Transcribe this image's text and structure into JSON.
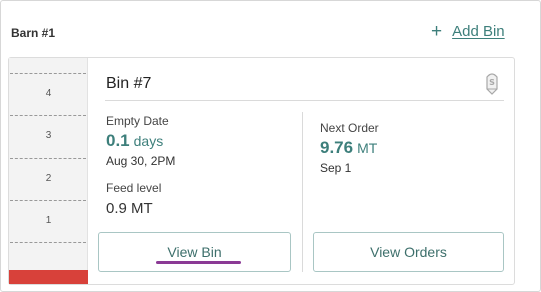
{
  "barn": {
    "name": "Barn #1"
  },
  "actions": {
    "add_bin_icon": "plus-icon",
    "add_bin_label": "Add Bin"
  },
  "bin": {
    "title": "Bin #7",
    "status_icon": "feed-bin-icon",
    "gauge": {
      "levels": [
        "4",
        "3",
        "2",
        "1"
      ],
      "fill_fraction": 0.06,
      "fill_color": "#d8413a"
    },
    "empty_date": {
      "label": "Empty Date",
      "value": "0.1",
      "unit": "days",
      "date": "Aug 30, 2PM"
    },
    "feed_level": {
      "label": "Feed level",
      "value": "0.9 MT"
    },
    "next_order": {
      "label": "Next Order",
      "value": "9.76",
      "unit": "MT",
      "date": "Sep 1"
    },
    "buttons": {
      "view_bin": "View Bin",
      "view_orders": "View Orders"
    }
  },
  "colors": {
    "accent": "#3d7f7b",
    "alert": "#d8413a",
    "focus_underline": "#8b3a95"
  }
}
